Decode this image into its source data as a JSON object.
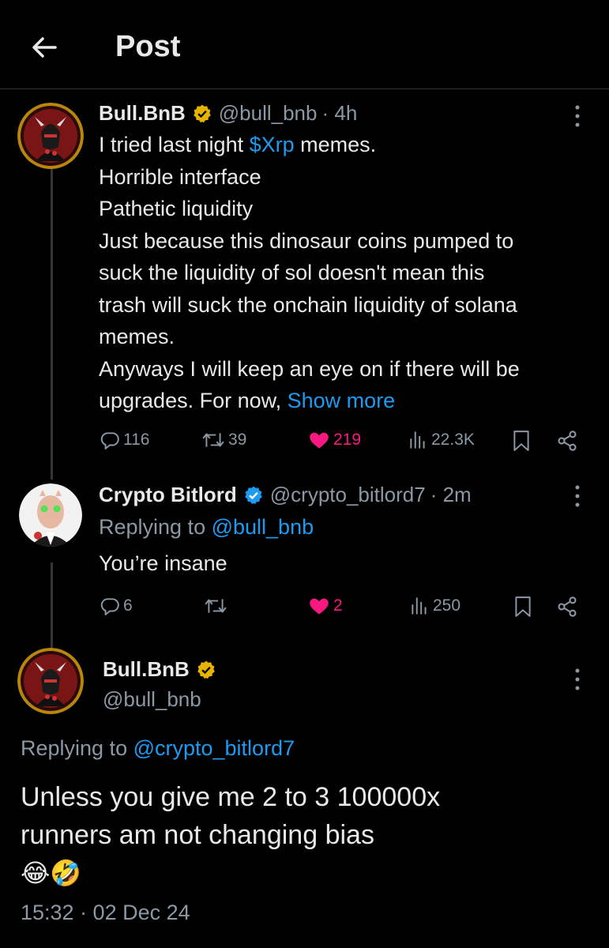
{
  "header": {
    "title": "Post"
  },
  "post1": {
    "name": "Bull.BnB",
    "handle": "@bull_bnb",
    "time": "· 4h",
    "line1_pre": "I tried last night ",
    "line1_link": "$Xrp",
    "line1_post": " memes.",
    "lines": [
      "Horrible interface",
      "Pathetic liquidity",
      "Just because this dinosaur coins pumped to",
      "suck the liquidity of sol doesn't mean this",
      "trash will suck the onchain liquidity of solana",
      "memes.",
      "Anyways I will keep an eye on if there will be"
    ],
    "last_line": "upgrades. For now, ",
    "show_more": "Show more",
    "replies": "116",
    "reposts": "39",
    "likes": "219",
    "views": "22.3K"
  },
  "post2": {
    "name": "Crypto Bitlord",
    "handle": "@crypto_bitlord7",
    "time": "· 2m",
    "replying_label": "Replying to ",
    "replying_handle": "@bull_bnb",
    "text": "You’re insane",
    "replies": "6",
    "reposts": "",
    "likes": "2",
    "views": "250"
  },
  "post3": {
    "name": "Bull.BnB",
    "handle": "@bull_bnb",
    "replying_label": "Replying to ",
    "replying_handle": "@crypto_bitlord7",
    "line1": "Unless you give me 2 to 3 100000x",
    "line2": "runners am not changing bias",
    "emojis": "😂🤣",
    "timestamp": "15:32 · 02 Dec 24"
  },
  "colors": {
    "background": "#000000",
    "text": "#e7e9ea",
    "secondary": "#8b98a5",
    "link": "#1d9bf0",
    "like": "#f91880",
    "gold_badge": "#e6b400",
    "blue_badge": "#1d9bf0"
  },
  "icons": [
    "back-arrow-icon",
    "verified-gold-icon",
    "verified-blue-icon",
    "more-icon",
    "reply-icon",
    "repost-icon",
    "heart-icon",
    "views-icon",
    "bookmark-icon",
    "share-icon"
  ]
}
